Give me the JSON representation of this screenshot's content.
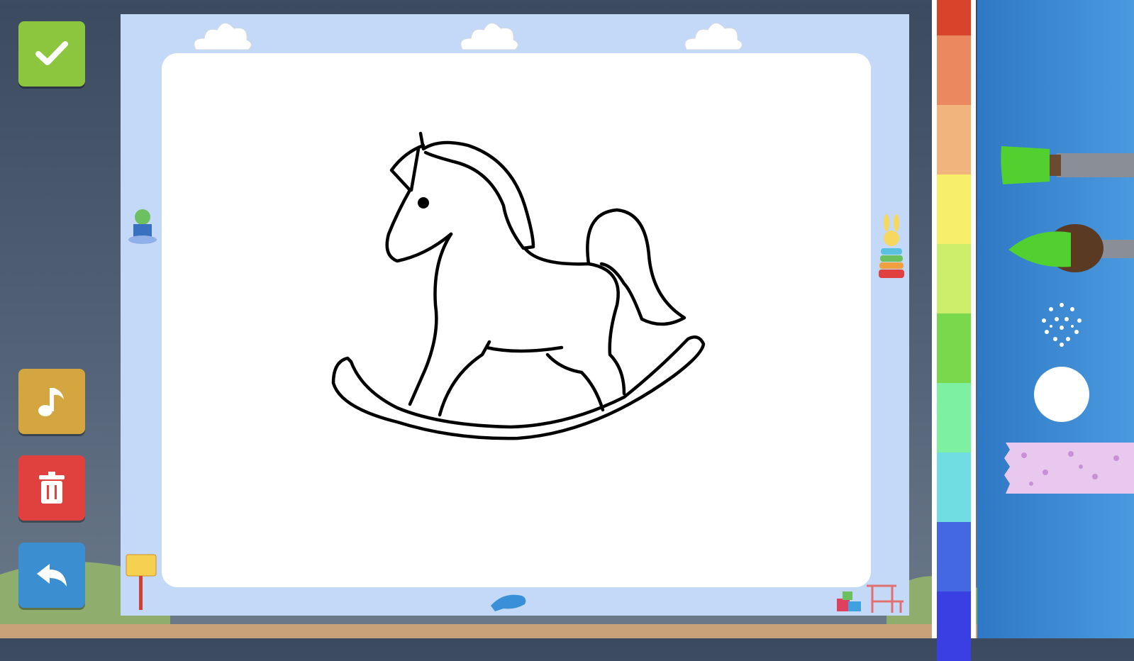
{
  "buttons": {
    "confirm": {
      "icon": "check-icon",
      "color": "#8cc63f"
    },
    "music": {
      "icon": "music-note-icon",
      "color": "#d4a640"
    },
    "clear": {
      "icon": "trash-icon",
      "color": "#e0413e"
    },
    "undo": {
      "icon": "undo-arrow-icon",
      "color": "#3b8fd0"
    }
  },
  "palette": {
    "colors": [
      "#d8432c",
      "#ec8860",
      "#f1b47c",
      "#f7ee6a",
      "#cdee6a",
      "#7ad84c",
      "#7ef0a2",
      "#70dde2",
      "#4368e2",
      "#3a3fe4"
    ]
  },
  "tools": [
    "flat-brush-icon",
    "round-brush-icon",
    "spray-icon",
    "eraser-circle-icon",
    "pattern-tape-icon"
  ]
}
